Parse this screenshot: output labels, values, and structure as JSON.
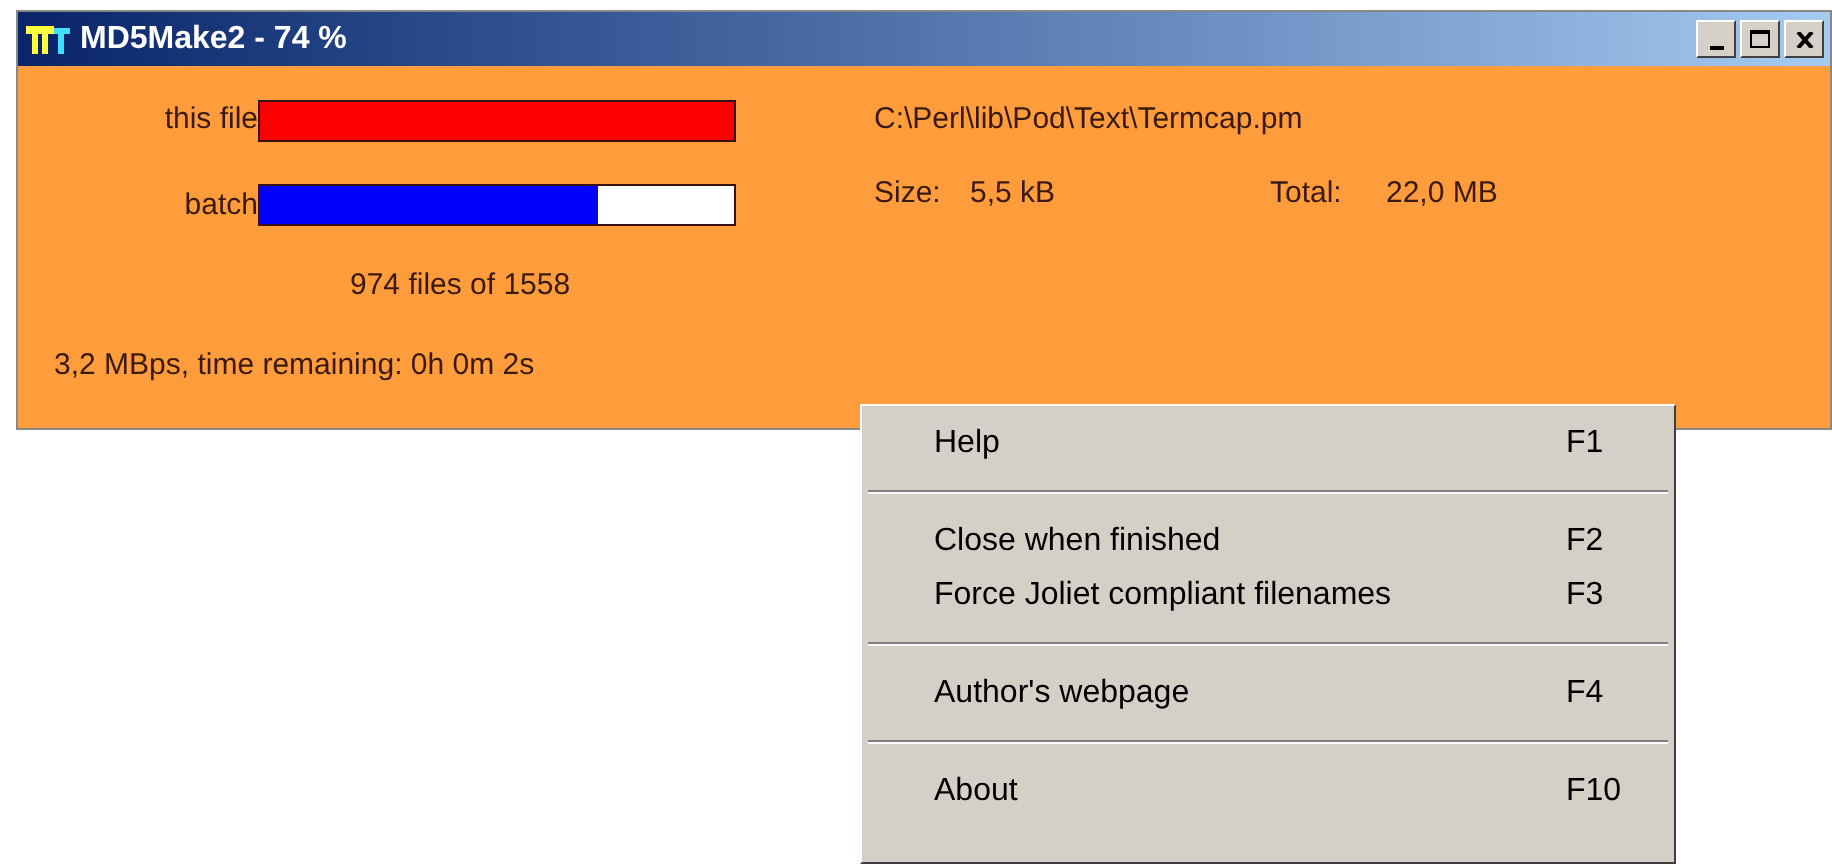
{
  "window": {
    "title": "MD5Make2 - 74 %"
  },
  "progress": [
    {
      "label": "this file",
      "level": 1.0,
      "color": "#ff0000"
    },
    {
      "label": "batch",
      "level": 0.715,
      "color": "#0000ff"
    }
  ],
  "file_count": "974  files of 1558",
  "speed": "3,2 MBps, time remaining:  0h 0m 2s",
  "file_path": "C:\\Perl\\lib\\Pod\\Text\\Termcap.pm",
  "size_label": "Size:",
  "size_value": "5,5 kB",
  "total_label": "Total:",
  "total_value": "22,0 MB",
  "context_menu": [
    {
      "kind": "item",
      "label": "Help",
      "shortcut": "F1"
    },
    {
      "kind": "separator"
    },
    {
      "kind": "item",
      "label": "Close when finished",
      "shortcut": "F2"
    },
    {
      "kind": "item",
      "label": "Force Joliet compliant filenames",
      "shortcut": "F3"
    },
    {
      "kind": "separator"
    },
    {
      "kind": "item",
      "label": "Author's webpage",
      "shortcut": "F4"
    },
    {
      "kind": "separator"
    },
    {
      "kind": "item",
      "label": "About",
      "shortcut": "F10"
    }
  ]
}
